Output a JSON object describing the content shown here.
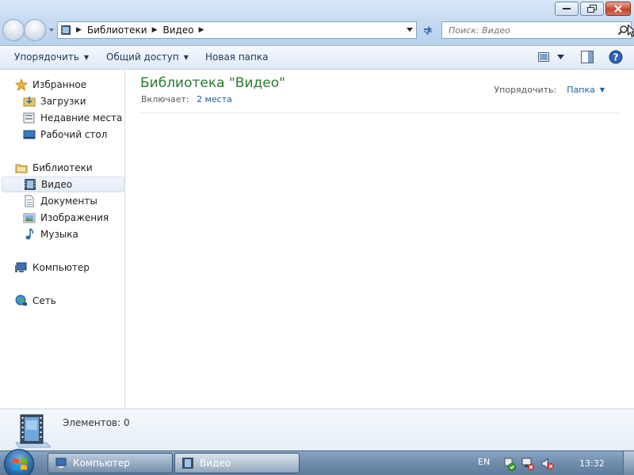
{
  "window": {
    "buttons": {
      "minimize": "minimize-icon",
      "maximize": "restore-icon",
      "close": "close-icon"
    }
  },
  "address_bar": {
    "crumbs": [
      "Библиотеки",
      "Видео"
    ],
    "icon": "video-library-icon"
  },
  "search": {
    "placeholder": "Поиск: Видео"
  },
  "toolbar": {
    "organize_label": "Упорядочить",
    "share_label": "Общий доступ",
    "new_folder_label": "Новая папка"
  },
  "navigation": {
    "favorites": {
      "label": "Избранное",
      "items": [
        "Загрузки",
        "Недавние места",
        "Рабочий стол"
      ]
    },
    "libraries": {
      "label": "Библиотеки",
      "items": [
        "Видео",
        "Документы",
        "Изображения",
        "Музыка"
      ],
      "selected": "Видео"
    },
    "computer_label": "Компьютер",
    "network_label": "Сеть"
  },
  "content": {
    "library_title": "Библиотека \"Видео\"",
    "includes_label": "Включает:",
    "includes_link": "2 места",
    "arrange_label": "Упорядочить:",
    "arrange_value": "Папка"
  },
  "details": {
    "items_count": "Элементов: 0"
  },
  "taskbar": {
    "tasks": [
      {
        "label": "Компьютер",
        "active": false
      },
      {
        "label": "Видео",
        "active": true
      }
    ],
    "language": "EN",
    "clock": "13:32"
  },
  "colors": {
    "accent_green": "#267d2b",
    "link_blue": "#1e5ea8",
    "taskbar": "#6f8cab"
  }
}
